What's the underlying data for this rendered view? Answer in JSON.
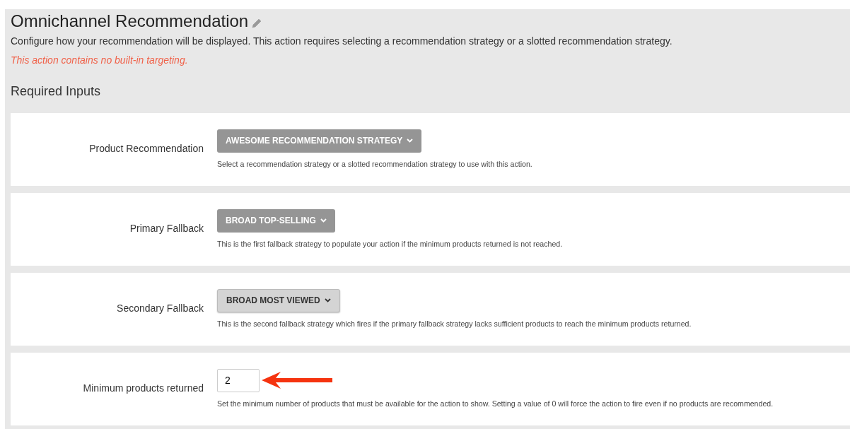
{
  "header": {
    "title": "Omnichannel Recommendation",
    "description": "Configure how your recommendation will be displayed. This action requires selecting a recommendation strategy or a slotted recommendation strategy.",
    "warning": "This action contains no built-in targeting."
  },
  "section_title": "Required Inputs",
  "inputs": [
    {
      "kind": "dropdown",
      "label": "Product Recommendation",
      "value": "AWESOME RECOMMENDATION STRATEGY",
      "highlighted": false,
      "help": "Select a recommendation strategy or a slotted recommendation strategy to use with this action."
    },
    {
      "kind": "dropdown",
      "label": "Primary Fallback",
      "value": "BROAD TOP-SELLING",
      "highlighted": false,
      "help": "This is the first fallback strategy to populate your action if the minimum products returned is not reached."
    },
    {
      "kind": "dropdown",
      "label": "Secondary Fallback",
      "value": "BROAD MOST VIEWED",
      "highlighted": true,
      "help": "This is the second fallback strategy which fires if the primary fallback strategy lacks sufficient products to reach the minimum products returned."
    },
    {
      "kind": "number",
      "label": "Minimum products returned",
      "value": "2",
      "help": "Set the minimum number of products that must be available for the action to show. Setting a value of 0 will force the action to fire even if no products are recommended."
    }
  ]
}
